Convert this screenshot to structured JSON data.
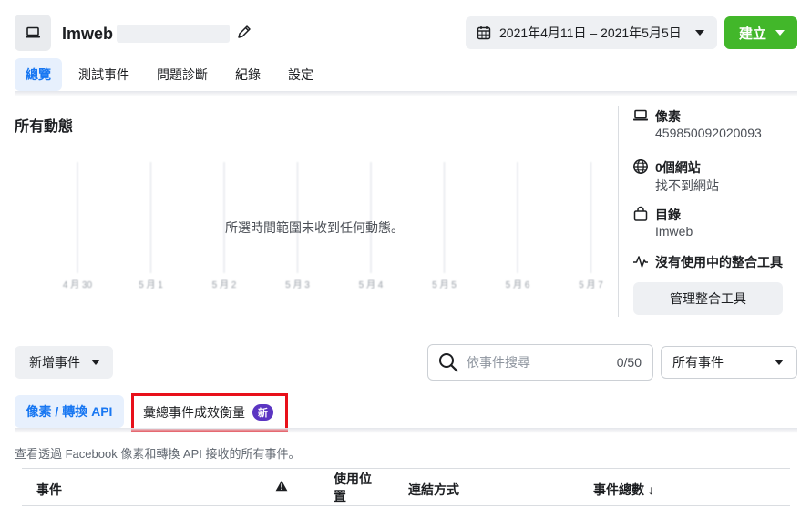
{
  "header": {
    "title": "Imweb",
    "date_range": "2021年4月11日 – 2021年5月5日",
    "create_label": "建立"
  },
  "nav": {
    "tabs": [
      "總覽",
      "測試事件",
      "問題診斷",
      "紀錄",
      "設定"
    ],
    "active_index": 0
  },
  "activity": {
    "title": "所有動態",
    "empty_message": "所選時間範圍未收到任何動態。",
    "chart_data": {
      "type": "line",
      "categories": [
        "4 月 30",
        "5 月 1",
        "5 月 2",
        "5 月 3",
        "5 月 4",
        "5 月 5",
        "5 月 6",
        "5 月 7"
      ],
      "series": [],
      "xlabel": "",
      "ylabel": "",
      "grid": true
    }
  },
  "info_panel": {
    "pixel": {
      "icon": "laptop-icon",
      "title": "像素",
      "value": "459850092020093"
    },
    "websites": {
      "icon": "globe-icon",
      "title": "0個網站",
      "value": "找不到網站"
    },
    "catalog": {
      "icon": "shopping-bag-icon",
      "title": "目錄",
      "value": "Imweb"
    },
    "integrations": {
      "icon": "activity-icon",
      "title": "沒有使用中的整合工具"
    },
    "manage_label": "管理整合工具"
  },
  "controls": {
    "add_event_label": "新增事件",
    "search_placeholder": "依事件搜尋",
    "search_count": "0/50",
    "filter_label": "所有事件"
  },
  "sub_tabs": {
    "pixel_api": "像素 / 轉換 API",
    "aggregated": "彙總事件成效衡量",
    "new_badge": "新"
  },
  "description": "查看透過 Facebook 像素和轉換 API 接收的所有事件。",
  "table": {
    "columns": [
      "事件",
      "使用位置",
      "連結方式",
      "事件總數 ↓"
    ],
    "warning_icon": "warning-icon"
  },
  "colors": {
    "primary_blue": "#1877f2",
    "create_green": "#42b72a",
    "highlight_red": "#e8101a",
    "new_badge_purple": "#5b35c2"
  }
}
